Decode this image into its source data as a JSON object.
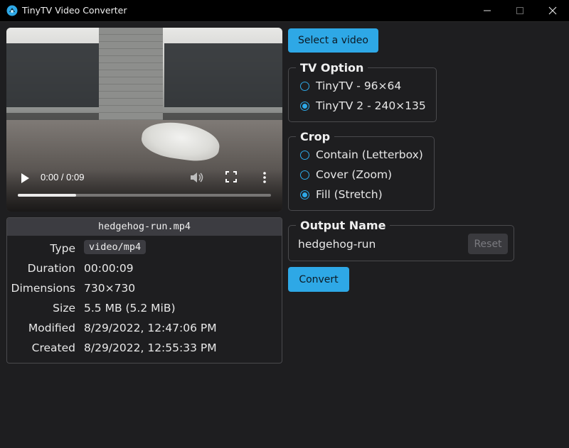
{
  "window": {
    "title": "TinyTV Video Converter",
    "icons": [
      "app-icon",
      "minimize-icon",
      "maximize-icon",
      "close-icon"
    ]
  },
  "video": {
    "time": "0:00 / 0:09",
    "progress": 0.23,
    "controls": [
      "play-icon",
      "volume-icon",
      "fullscreen-icon",
      "more-options-icon"
    ]
  },
  "file": {
    "name": "hedgehog-run.mp4",
    "rows": [
      {
        "label": "Type",
        "value": "video/mp4"
      },
      {
        "label": "Duration",
        "value": "00:00:09"
      },
      {
        "label": "Dimensions",
        "value": "730×730"
      },
      {
        "label": "Size",
        "value": "5.5 MB (5.2 MiB)"
      },
      {
        "label": "Modified",
        "value": "8/29/2022, 12:47:06 PM"
      },
      {
        "label": "Created",
        "value": "8/29/2022, 12:55:33 PM"
      }
    ]
  },
  "select_button": "Select a video",
  "tv_option": {
    "legend": "TV Option",
    "options": [
      {
        "label": "TinyTV - 96×64",
        "checked": false
      },
      {
        "label": "TinyTV 2 - 240×135",
        "checked": true
      }
    ]
  },
  "crop": {
    "legend": "Crop",
    "options": [
      {
        "label": "Contain (Letterbox)",
        "checked": false
      },
      {
        "label": "Cover (Zoom)",
        "checked": false
      },
      {
        "label": "Fill (Stretch)",
        "checked": true
      }
    ]
  },
  "output": {
    "legend": "Output Name",
    "value": "hedgehog-run",
    "reset_label": "Reset"
  },
  "convert_button": "Convert",
  "colors": {
    "accent": "#2ea8e6",
    "background": "#1e1e20",
    "titlebar": "#000000"
  }
}
